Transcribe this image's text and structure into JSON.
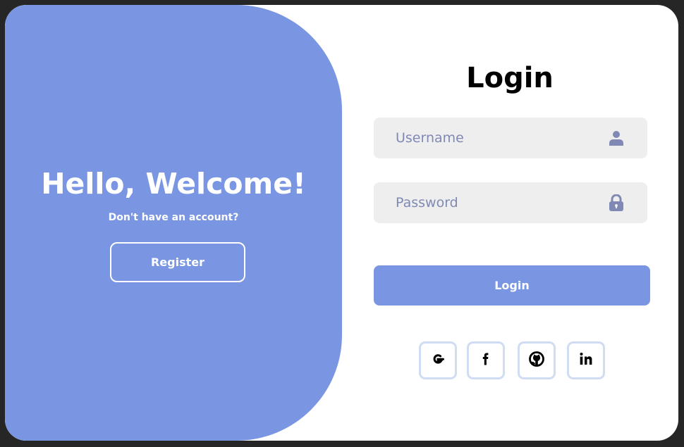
{
  "welcome": {
    "title": "Hello, Welcome!",
    "subtitle": "Don't have an account?",
    "register_label": "Register"
  },
  "login": {
    "title": "Login",
    "username_placeholder": "Username",
    "password_placeholder": "Password",
    "submit_label": "Login"
  },
  "social": [
    {
      "icon": "google-icon"
    },
    {
      "icon": "facebook-icon"
    },
    {
      "icon": "github-icon"
    },
    {
      "icon": "linkedin-icon"
    }
  ],
  "colors": {
    "accent": "#7a96e3",
    "input_bg": "#eeeeee",
    "placeholder": "#8089b4",
    "social_border": "#cfdcf2"
  }
}
